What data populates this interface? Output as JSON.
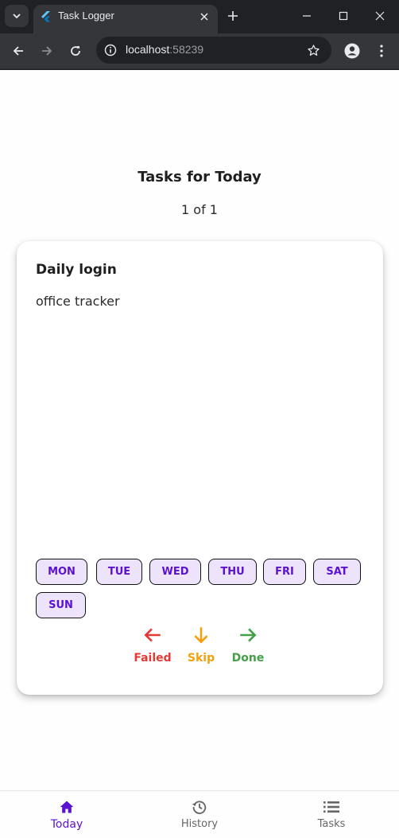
{
  "browser": {
    "tab_title": "Task Logger",
    "url_host": "localhost",
    "url_port": ":58239"
  },
  "page": {
    "title": "Tasks for Today",
    "counter": "1 of 1"
  },
  "task": {
    "title": "Daily login",
    "description": "office tracker",
    "days": [
      "MON",
      "TUE",
      "WED",
      "THU",
      "FRI",
      "SAT",
      "SUN"
    ]
  },
  "actions": {
    "failed": "Failed",
    "skip": "Skip",
    "done": "Done"
  },
  "bottom_nav": {
    "today": "Today",
    "history": "History",
    "tasks": "Tasks"
  },
  "colors": {
    "accent": "#5b11d0",
    "failed": "#e53935",
    "skip": "#f59f0b",
    "done": "#43a047",
    "chip_bg": "#ede4fb"
  }
}
